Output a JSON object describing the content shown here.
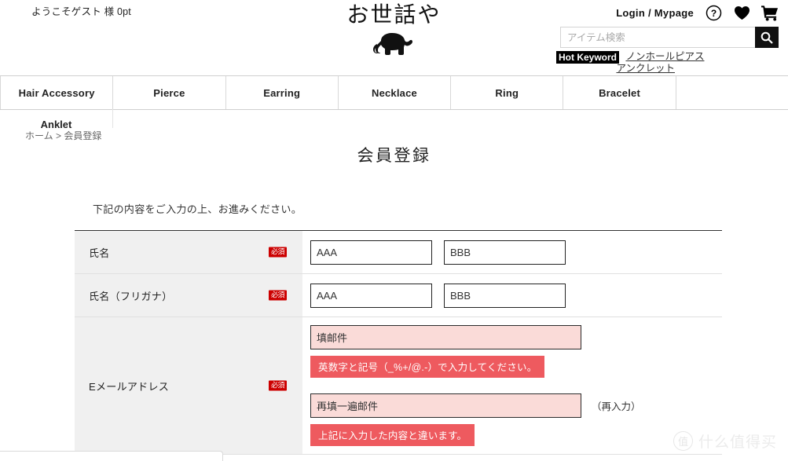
{
  "header": {
    "welcome": "ようこそゲスト 様 0pt",
    "logo_text": "お世話や",
    "logo_icon": "elephant-icon",
    "login_label": "Login / Mypage",
    "help_icon": "question-mark-icon",
    "favorite_icon": "heart-icon",
    "cart_icon": "shopping-cart-icon",
    "search": {
      "placeholder": "アイテム検索",
      "value": "",
      "button_icon": "search-icon"
    },
    "hot_keyword": {
      "badge": "Hot Keyword",
      "links": [
        "ノンホールピアス",
        "アンクレット"
      ]
    }
  },
  "nav": {
    "items": [
      "Hair Accessory",
      "Pierce",
      "Earring",
      "Necklace",
      "Ring",
      "Bracelet"
    ],
    "wrapped_item": "Anklet"
  },
  "breadcrumb": {
    "home": "ホーム",
    "separator": ">",
    "current": "会員登録"
  },
  "main": {
    "title": "会員登録",
    "intro": "下記の内容をご入力の上、お進みください。",
    "required_badge": "必須",
    "rows": [
      {
        "label": "氏名",
        "required": true,
        "values": [
          "AAA",
          "BBB"
        ]
      },
      {
        "label": "氏名（フリガナ）",
        "required": true,
        "values": [
          "AAA",
          "BBB"
        ]
      }
    ],
    "email": {
      "label": "Eメールアドレス",
      "required": true,
      "value": "填邮件",
      "error": "英数字と記号（_%+/@.-）で入力してください。",
      "confirm_value": "再填一遍邮件",
      "confirm_note": "（再入力）",
      "confirm_error": "上記に入力した内容と違います。"
    }
  },
  "watermark": {
    "logo": "值",
    "text": "什么值得买"
  },
  "colors": {
    "error_bg": "#ee5a5f",
    "error_field_bg": "#fadbd8",
    "required_badge": "#cc0000",
    "label_bg": "#f0f0f0",
    "accent_dark": "#000000"
  }
}
